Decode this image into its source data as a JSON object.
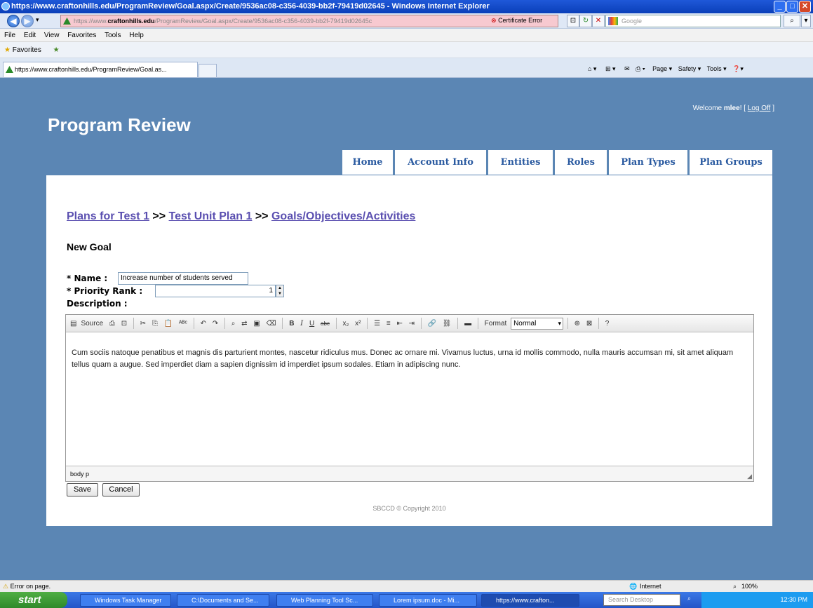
{
  "window": {
    "title": "https://www.craftonhills.edu/ProgramReview/Goal.aspx/Create/9536ac08-c356-4039-bb2f-79419d02645 - Windows Internet Explorer"
  },
  "browser": {
    "address_prefix": "https://www.",
    "address_domain": "craftonhills.edu",
    "address_suffix": "/ProgramReview/Goal.aspx/Create/9536ac08-c356-4039-bb2f-79419d02645c",
    "cert_error": "Certificate Error",
    "search_placeholder": "Google",
    "menu": [
      "File",
      "Edit",
      "View",
      "Favorites",
      "Tools",
      "Help"
    ],
    "favorites_label": "Favorites",
    "tab_title": "https://www.craftonhills.edu/ProgramReview/Goal.as...",
    "cmd": {
      "page": "Page ▾",
      "safety": "Safety ▾",
      "tools": "Tools ▾"
    }
  },
  "site": {
    "welcome_prefix": "Welcome ",
    "welcome_user": "mlee",
    "welcome_sep": "! [ ",
    "logoff": "Log Off",
    "welcome_end": " ]",
    "brand": "Program Review",
    "nav": [
      "Home",
      "Account Info",
      "Entities",
      "Roles",
      "Plan Types",
      "Plan Groups"
    ]
  },
  "breadcrumb": {
    "crumb1": "Plans for Test 1",
    "sep": " >> ",
    "crumb2": "Test Unit Plan 1",
    "crumb3": "Goals/Objectives/Activities"
  },
  "form": {
    "heading": "New Goal",
    "name_label": "* Name :",
    "name_value": "Increase number of students served",
    "priority_label": "* Priority Rank :",
    "priority_value": "1",
    "description_label": "Description :",
    "toolbar": {
      "source": "Source",
      "format_label": "Format",
      "format_value": "Normal"
    },
    "description_text": "Cum sociis natoque penatibus et magnis dis parturient montes, nascetur ridiculus mus. Donec ac ornare mi. Vivamus luctus, urna id mollis commodo, nulla mauris accumsan mi, sit amet aliquam tellus quam a augue. Sed imperdiet diam a sapien dignissim id imperdiet ipsum sodales. Etiam in adipiscing nunc.",
    "editor_path": "body  p",
    "save": "Save",
    "cancel": "Cancel"
  },
  "footer": {
    "copyright": "SBCCD © Copyright 2010"
  },
  "status": {
    "error": "Error on page.",
    "zone": "Internet",
    "zoom": "100%"
  },
  "taskbar": {
    "start": "start",
    "tasks": [
      "Windows Task Manager",
      "C:\\Documents and Se...",
      "Web Planning Tool Sc...",
      "Lorem ipsum.doc - Mi...",
      "https://www.crafton..."
    ],
    "search": "Search Desktop",
    "clock": "12:30 PM"
  }
}
